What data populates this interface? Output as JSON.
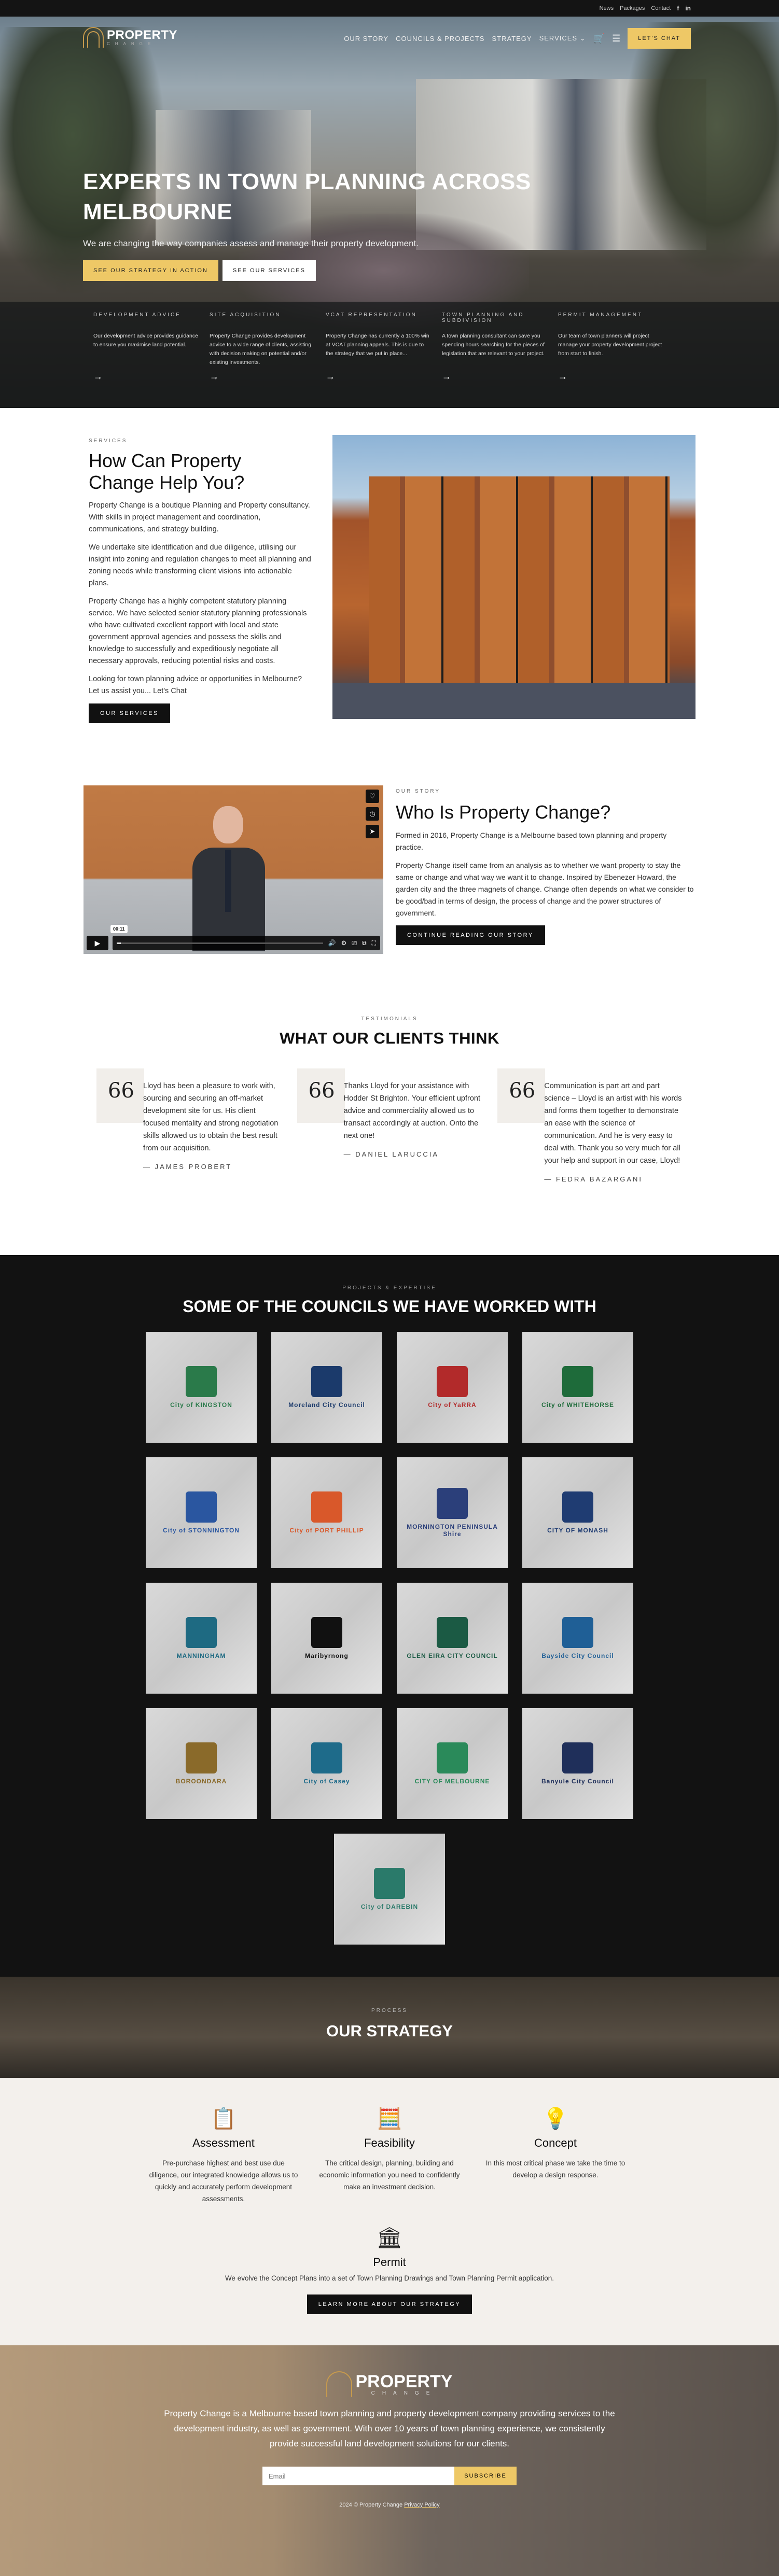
{
  "topbar": {
    "links": [
      "News",
      "Packages",
      "Contact"
    ],
    "social": [
      {
        "name": "facebook-icon",
        "glyph": "f"
      },
      {
        "name": "linkedin-icon",
        "glyph": "in"
      }
    ]
  },
  "brand": {
    "name": "PROPERTY",
    "tagline": "CHANGE",
    "accent": "#c69a4d"
  },
  "nav": {
    "items": [
      "OUR STORY",
      "COUNCILS & PROJECTS",
      "STRATEGY",
      "SERVICES"
    ],
    "services_chevron": "⌄",
    "cart_icon": "🛒",
    "menu_icon": "☰",
    "cta": "LET'S CHAT"
  },
  "hero": {
    "title": "EXPERTS IN TOWN PLANNING ACROSS MELBOURNE",
    "subtitle": "We are changing the way companies assess and manage their property development.",
    "cta_primary": "SEE OUR STRATEGY IN ACTION",
    "cta_secondary": "SEE OUR SERVICES",
    "services": [
      {
        "title": "DEVELOPMENT ADVICE",
        "text": "Our development advice provides guidance to ensure you maximise land potential.",
        "arrow": "→"
      },
      {
        "title": "SITE ACQUISITION",
        "text": "Property Change provides development advice to a wide range of clients, assisting with decision making on potential and/or existing investments.",
        "arrow": "→"
      },
      {
        "title": "VCAT REPRESENTATION",
        "text": "Property Change has currently a 100% win at VCAT planning appeals. This is due to the strategy that we put in place...",
        "arrow": "→"
      },
      {
        "title": "TOWN PLANNING AND SUBDIVISION",
        "text": "A town planning consultant can save you spending hours searching for the pieces of legislation that are relevant to your project.",
        "arrow": "→"
      },
      {
        "title": "PERMIT MANAGEMENT",
        "text": "Our team of town planners will project manage your property development project from start to finish.",
        "arrow": "→"
      }
    ]
  },
  "services_section": {
    "eyebrow": "SERVICES",
    "title": "How Can Property Change Help You?",
    "paragraphs": [
      "Property Change is a boutique Planning and Property consultancy. With skills in project management and coordination, communications, and strategy building.",
      "We undertake site identification and due diligence, utilising our insight into zoning and regulation changes to meet all planning and zoning needs while transforming client visions into actionable plans.",
      "Property Change has a highly competent statutory planning service. We have selected senior statutory planning professionals who have cultivated excellent rapport with local and state government approval agencies and possess the skills and knowledge to successfully and expeditiously negotiate all necessary approvals, reducing potential risks and costs.",
      "Looking for town planning advice or opportunities in Melbourne? Let us assist you... Let's Chat"
    ],
    "button": "OUR SERVICES"
  },
  "story": {
    "video": {
      "timecode": "00:11",
      "progress": 0.02,
      "side_icons": [
        "♡",
        "◷",
        "➤"
      ],
      "play_icon": "▶",
      "control_icons": [
        "🔊",
        "⚙",
        "⎚",
        "⧉",
        "⛶"
      ]
    },
    "eyebrow": "OUR STORY",
    "title": "Who Is Property Change?",
    "paragraphs": [
      "Formed in 2016, Property Change is a Melbourne based town planning and property practice.",
      "Property Change itself came from an analysis as to whether we want property to stay the same or change and what way we want it to change. Inspired by Ebenezer Howard, the garden city and the three magnets of change. Change often depends on what we consider to be good/bad in terms of design, the process of change and the power structures of government."
    ],
    "button": "CONTINUE READING OUR STORY"
  },
  "testimonials": {
    "eyebrow": "TESTIMONIALS",
    "title": "WHAT OUR CLIENTS THINK",
    "quote_glyph": "66",
    "items": [
      {
        "text": "Lloyd has been a pleasure to work with, sourcing and securing an off-market development site for us. His client focused mentality and strong negotiation skills allowed us to obtain the best result from our acquisition.",
        "author": "— JAMES PROBERT"
      },
      {
        "text": "Thanks Lloyd for your assistance with Hodder St Brighton. Your efficient upfront advice and commerciality allowed us to transact accordingly at auction. Onto the next one!",
        "author": "— DANIEL LARUCCIA"
      },
      {
        "text": "Communication is part art and part science – Lloyd is an artist with his words and forms them together to demonstrate an ease with the science of communication. And he is very easy to deal with. Thank you so very much for all your help and support in our case, Lloyd!",
        "author": "— FEDRA BAZARGANI"
      }
    ]
  },
  "councils": {
    "eyebrow": "PROJECTS & EXPERTISE",
    "title": "SOME OF THE COUNCILS WE HAVE WORKED WITH",
    "items": [
      {
        "name": "City of KINGSTON",
        "color": "#2a7a4a"
      },
      {
        "name": "Moreland City Council",
        "color": "#1b3a6b"
      },
      {
        "name": "City of YaRRA",
        "color": "#b22a2a"
      },
      {
        "name": "City of WHITEHORSE",
        "color": "#1e6b3a"
      },
      {
        "name": "City of STONNINGTON",
        "color": "#2a56a0"
      },
      {
        "name": "City of PORT PHILLIP",
        "color": "#d9582a"
      },
      {
        "name": "MORNINGTON PENINSULA Shire",
        "color": "#2b3f7a"
      },
      {
        "name": "CITY OF MONASH",
        "color": "#1f3c72"
      },
      {
        "name": "MANNINGHAM",
        "color": "#1e6a82"
      },
      {
        "name": "Maribyrnong",
        "color": "#111111"
      },
      {
        "name": "GLEN EIRA CITY COUNCIL",
        "color": "#1b5a44"
      },
      {
        "name": "Bayside City Council",
        "color": "#1f5f96"
      },
      {
        "name": "BOROONDARA",
        "color": "#8a6a2a"
      },
      {
        "name": "City of Casey",
        "color": "#1e6b8a"
      },
      {
        "name": "CITY OF MELBOURNE",
        "color": "#2a8a5a"
      },
      {
        "name": "Banyule City Council",
        "color": "#1f2f5a"
      },
      {
        "name": "City of DAREBIN",
        "color": "#2a7a6a"
      }
    ]
  },
  "strategy": {
    "eyebrow": "PROCESS",
    "title": "OUR STRATEGY",
    "steps": [
      {
        "icon": "📋",
        "title": "Assessment",
        "text": "Pre-purchase highest and best use due diligence, our integrated knowledge allows us to quickly and accurately perform development assessments."
      },
      {
        "icon": "🧮",
        "title": "Feasibility",
        "text": "The critical design, planning, building and economic information you need to confidently make an investment decision."
      },
      {
        "icon": "💡",
        "title": "Concept",
        "text": "In this most critical phase we take the time to develop a design response."
      }
    ],
    "permit": {
      "icon": "🏛",
      "title": "Permit",
      "text": "We evolve the Concept Plans into a set of Town Planning Drawings and Town Planning Permit application."
    },
    "button": "LEARN MORE ABOUT OUR STRATEGY"
  },
  "footer": {
    "text": "Property Change is a Melbourne based town planning and property development company providing services to the development industry, as well as government. With over 10 years of town planning experience, we consistently provide successful land development solutions for our clients.",
    "email_placeholder": "Email",
    "subscribe": "SUBSCRIBE",
    "copyright": "2024 © Property Change",
    "privacy": "Privacy Policy"
  }
}
